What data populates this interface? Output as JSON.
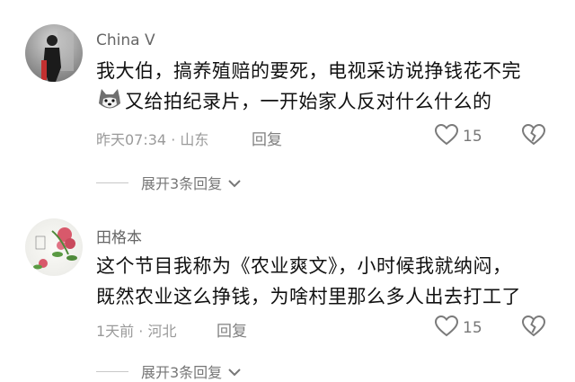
{
  "comments": [
    {
      "username": "China V",
      "line1": "我大伯，搞养殖赔的要死，电视采访说挣钱花不完",
      "line2": "又给拍纪录片，一开始家人反对什么什么的",
      "meta": "昨天07:34 · 山东",
      "reply_label": "回复",
      "likes": "15",
      "expand_label": "展开3条回复"
    },
    {
      "username": "田格本",
      "line1": "这个节目我称为《农业爽文》，小时候我就纳闷，",
      "line2": "既然农业这么挣钱，为啥村里那么多人出去打工了",
      "meta": "1天前 · 河北",
      "reply_label": "回复",
      "likes": "15",
      "expand_label": "展开3条回复"
    }
  ],
  "icons": {
    "like": "heart-outline-icon",
    "dislike": "broken-heart-icon",
    "expand": "chevron-down-icon",
    "emoji": "husky-dog-emoji"
  }
}
